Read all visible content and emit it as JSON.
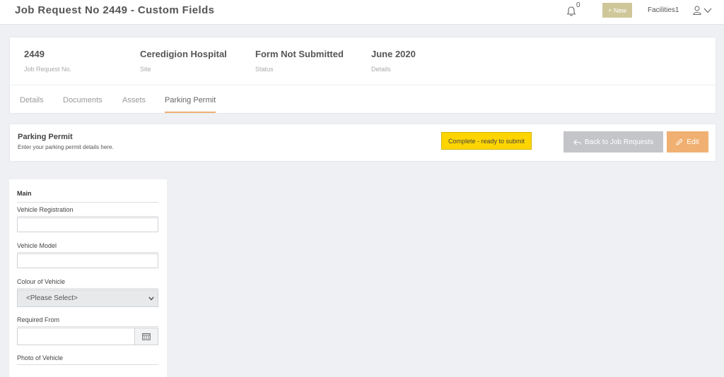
{
  "header": {
    "title": "Job Request No 2449 - Custom Fields",
    "notification_count": "0",
    "new_button": "+ New",
    "user_name": "Facilities1"
  },
  "summary": {
    "items": [
      {
        "value": "2449",
        "label": "Job Request No."
      },
      {
        "value": "Ceredigion Hospital",
        "label": "Site"
      },
      {
        "value": "Form Not Submitted",
        "label": "Status"
      },
      {
        "value": "June 2020",
        "label": "Details"
      }
    ],
    "tabs": [
      {
        "label": "Details"
      },
      {
        "label": "Documents"
      },
      {
        "label": "Assets"
      },
      {
        "label": "Parking Permit",
        "active": true
      }
    ]
  },
  "permit": {
    "title": "Parking Permit",
    "subtitle": "Enter your parking permit details here.",
    "status": "Complete - ready to submit",
    "back_button": "Back to Job Requests",
    "edit_button": "Edit"
  },
  "form": {
    "section": "Main",
    "fields": {
      "vehicle_registration": {
        "label": "Vehicle Registration",
        "value": ""
      },
      "vehicle_model": {
        "label": "Vehicle Model",
        "value": ""
      },
      "colour": {
        "label": "Colour of Vehicle",
        "selected": "<Please Select>"
      },
      "required_from": {
        "label": "Required From",
        "value": ""
      },
      "photo": {
        "label": "Photo of Vehicle"
      }
    }
  },
  "colors": {
    "accent": "#f0b071",
    "status_badge": "#ffd500",
    "new_button": "#cfc79a",
    "back_button": "#c3c5c8"
  },
  "icons": [
    "bell-icon",
    "user-icon",
    "chevron-down-icon",
    "back-arrow-icon",
    "pencil-icon",
    "calendar-icon"
  ]
}
